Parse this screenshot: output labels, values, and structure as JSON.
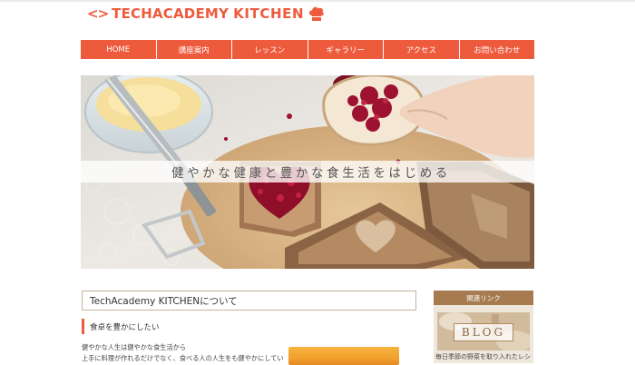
{
  "logo": {
    "bracket": "<>",
    "tech": "TECH",
    "academy": "ACADEMY",
    "kitchen": "KITCHEN",
    "icon": "chef-hat-icon",
    "color": "#ee5a3c"
  },
  "nav": {
    "color": "#ee5a3c",
    "items": [
      {
        "label": "HOME"
      },
      {
        "label": "講座案内"
      },
      {
        "label": "レッスン"
      },
      {
        "label": "ギャラリー"
      },
      {
        "label": "アクセス"
      },
      {
        "label": "お問い合わせ"
      }
    ]
  },
  "hero": {
    "caption": "健やかな健康と豊かな食生活をはじめる"
  },
  "about": {
    "title": "TechAcademy KITCHENについて",
    "subheading": "食卓を豊かにしたい",
    "lines": [
      "健やかな人生は健やかな食生活から",
      "上手に料理が作れるだけでなく、食べる人の人生をも健やかにしてい"
    ]
  },
  "sidebar": {
    "heading": "関連リンク",
    "heading_color": "#a77a4f",
    "blog_label": "BLOG",
    "blog_caption": "毎日季節の野菜を取り入れたレシ"
  }
}
